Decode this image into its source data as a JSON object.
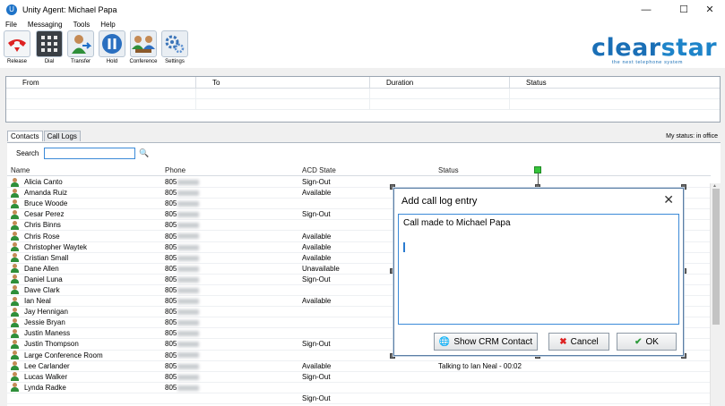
{
  "window": {
    "title": "Unity Agent: Michael Papa",
    "app_icon": "U"
  },
  "menu": [
    "File",
    "Messaging",
    "Tools",
    "Help"
  ],
  "toolbar": [
    {
      "label": "Release",
      "icon": "phone-hangup-icon"
    },
    {
      "label": "Dial",
      "icon": "dialpad-icon"
    },
    {
      "label": "Transfer",
      "icon": "transfer-icon"
    },
    {
      "label": "Hold",
      "icon": "pause-icon"
    },
    {
      "label": "Conference",
      "icon": "conference-icon"
    },
    {
      "label": "Settings",
      "icon": "gears-icon"
    }
  ],
  "logo": {
    "brand_a": "clear",
    "brand_b": "star",
    "tagline": "the next telephone system"
  },
  "calls": {
    "headers": [
      "From",
      "To",
      "Duration",
      "Status"
    ]
  },
  "tabs": [
    "Contacts",
    "Call Logs"
  ],
  "my_status": "My status: in office",
  "search": {
    "label": "Search",
    "value": ""
  },
  "contacts": {
    "headers": [
      "Name",
      "Phone",
      "ACD State",
      "Status"
    ],
    "rows": [
      {
        "name": "Alicia Canto",
        "phone": "805",
        "acd": "Sign-Out",
        "status": ""
      },
      {
        "name": "Amanda Ruiz",
        "phone": "805",
        "acd": "Available",
        "status": ""
      },
      {
        "name": "Bruce Woode",
        "phone": "805",
        "acd": "",
        "status": ""
      },
      {
        "name": "Cesar Perez",
        "phone": "805",
        "acd": "Sign-Out",
        "status": ""
      },
      {
        "name": "Chris Binns",
        "phone": "805",
        "acd": "",
        "status": ""
      },
      {
        "name": "Chris Rose",
        "phone": "805",
        "acd": "Available",
        "status": ""
      },
      {
        "name": "Christopher Waytek",
        "phone": "805",
        "acd": "Available",
        "status": ""
      },
      {
        "name": "Cristian Small",
        "phone": "805",
        "acd": "Available",
        "status": ""
      },
      {
        "name": "Dane Allen",
        "phone": "805",
        "acd": "Unavailable",
        "status": ""
      },
      {
        "name": "Daniel Luna",
        "phone": "805",
        "acd": "Sign-Out",
        "status": ""
      },
      {
        "name": "Dave Clark",
        "phone": "805",
        "acd": "",
        "status": ""
      },
      {
        "name": "Ian Neal",
        "phone": "805",
        "acd": "Available",
        "status": ""
      },
      {
        "name": "Jay Hennigan",
        "phone": "805",
        "acd": "",
        "status": ""
      },
      {
        "name": "Jessie Bryan",
        "phone": "805",
        "acd": "",
        "status": ""
      },
      {
        "name": "Justin Maness",
        "phone": "805",
        "acd": "",
        "status": ""
      },
      {
        "name": "Justin Thompson",
        "phone": "805",
        "acd": "Sign-Out",
        "status": ""
      },
      {
        "name": "Large Conference Room",
        "phone": "805",
        "acd": "",
        "status": ""
      },
      {
        "name": "Lee Carlander",
        "phone": "805",
        "acd": "Available",
        "status": "Talking to Ian Neal - 00:02"
      },
      {
        "name": "Lucas Walker",
        "phone": "805",
        "acd": "Sign-Out",
        "status": ""
      },
      {
        "name": "Lynda Radke",
        "phone": "805",
        "acd": "",
        "status": ""
      },
      {
        "name": "",
        "phone": "",
        "acd": "Sign-Out",
        "status": ""
      }
    ]
  },
  "dialog": {
    "title": "Add call log entry",
    "text": "Call made to Michael Papa",
    "buttons": {
      "crm": "Show CRM Contact",
      "cancel": "Cancel",
      "ok": "OK"
    }
  }
}
